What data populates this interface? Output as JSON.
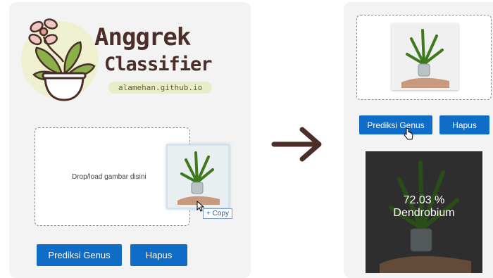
{
  "app": {
    "title_line1": "Anggrek",
    "title_line2": "Classifier",
    "link": "alamehan.github.io"
  },
  "left": {
    "dropzone_text": "Drop/load gambar disini",
    "copy_badge": "+ Copy",
    "predict_label": "Prediksi Genus",
    "clear_label": "Hapus"
  },
  "right": {
    "predict_label": "Prediksi Genus",
    "clear_label": "Hapus",
    "result_percent": "72.03 %",
    "result_genus": "Dendrobium"
  },
  "colors": {
    "accent": "#0f6cc7",
    "brand_brown": "#4b2e27",
    "panel": "#f3f3f3"
  },
  "icons": [
    "orchid-logo-icon",
    "arrow-right-icon",
    "cursor-icon",
    "hand-cursor-icon"
  ]
}
